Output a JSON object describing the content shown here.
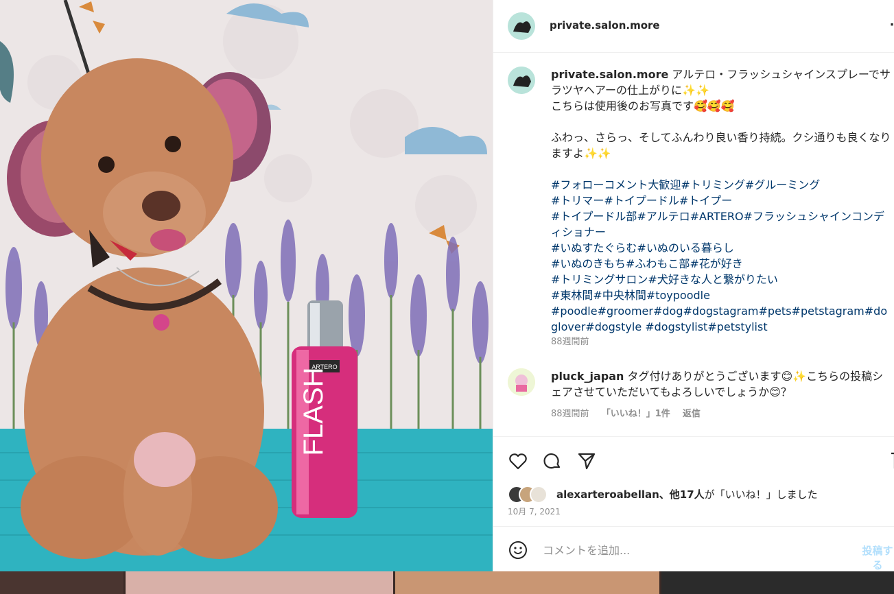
{
  "header": {
    "username": "private.salon.more"
  },
  "photo": {
    "product_label": "FLASH",
    "brand_label": "ARTERO"
  },
  "caption": {
    "username": "private.salon.more",
    "line1": "アルテロ・フラッシュシャインスプレーでサラツヤヘアーの仕上がりに✨✨",
    "line2": "こちらは使用後のお写真です🥰🥰🥰",
    "line3": "ふわっ、さらっ、そしてふんわり良い香り持続。クシ通りも良くなりますよ✨✨",
    "hashtags": "#フォローコメント大歓迎#トリミング#グルーミング\n#トリマー#トイプードル#トイプー\n#トイプードル部#アルテロ#ARTERO#フラッシュシャインコンディショナー\n#いぬすたぐらむ#いぬのいる暮らし\n#いぬのきもち#ふわもこ部#花が好き\n#トリミングサロン#犬好きな人と繋がりたい\n#東林間#中央林間#toypoodle\n#poodle#groomer#dog#dogstagram#pets#petstagram#doglover#dogstyle #dogstylist#petstylist",
    "time": "88週間前"
  },
  "reply": {
    "username": "pluck_japan",
    "text": "タグ付けありがとうございます😊✨こちらの投稿シェアさせていただいてもよろしいでしょうか😊？",
    "time": "88週間前",
    "likes": "「いいね！」1件",
    "reply_label": "返信"
  },
  "likes": {
    "username": "alexarteroabellan",
    "others": "、他17人",
    "suffix": "が「いいね！」しました"
  },
  "post_date": "10月 7, 2021",
  "comment_box": {
    "placeholder": "コメントを追加...",
    "post_label": "投稿する"
  },
  "icons": [
    "more-icon",
    "heart-icon",
    "comment-icon",
    "share-icon",
    "save-icon",
    "emoji-icon"
  ],
  "colors": {
    "text": "#262626",
    "secondary": "#8e8e8e",
    "hashtag": "#00376b",
    "post_button": "#b2dffc"
  }
}
